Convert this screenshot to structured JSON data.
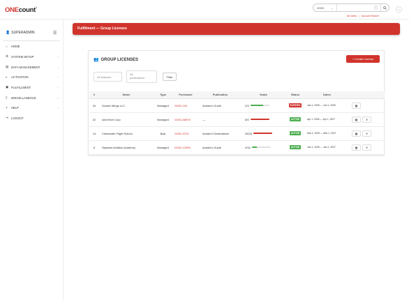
{
  "header": {
    "logo_one": "ONE",
    "logo_count": "count",
    "logo_tm": "®",
    "search_category": "GOID",
    "search_placeholder": "",
    "search_shortcut": "/",
    "link_all_users": "All Users",
    "link_separator": "|",
    "link_account_search": "Account Search"
  },
  "sidebar": {
    "user": "SUPERADMIN",
    "items": [
      {
        "label": "HOME",
        "icon": "home-icon",
        "glyph": "⌂",
        "arrow": ""
      },
      {
        "label": "SYSTEM SETUP",
        "icon": "gear-icon",
        "glyph": "⚙",
        "arrow": "‹"
      },
      {
        "label": "DATA MANAGEMENT",
        "icon": "database-icon",
        "glyph": "▤",
        "arrow": "‹"
      },
      {
        "label": "ACTIVATION",
        "icon": "toggle-icon",
        "glyph": "◐",
        "arrow": "‹"
      },
      {
        "label": "FULFILLMENT",
        "icon": "box-icon",
        "glyph": "▣",
        "arrow": "‹"
      },
      {
        "label": "MISCELLANEOUS",
        "icon": "file-icon",
        "glyph": "▯",
        "arrow": "‹"
      },
      {
        "label": "HELP",
        "icon": "question-icon",
        "glyph": "?",
        "arrow": "‹"
      },
      {
        "label": "LOGOUT",
        "icon": "logout-icon",
        "glyph": "⇥",
        "arrow": ""
      }
    ]
  },
  "banner": {
    "title": "Fulfillment — Group Licenses"
  },
  "card": {
    "title": "GROUP LICENSES",
    "create_label": "+ Create License",
    "filter_status": "All statuses",
    "filter_pub_line1": "All",
    "filter_pub_line2": "publications",
    "filter_button": "Filter"
  },
  "table": {
    "columns": [
      "#",
      "Name",
      "Type",
      "Purchaser",
      "Publication",
      "Seats",
      "Status",
      "Dates",
      ""
    ],
    "rows": [
      {
        "id": "20",
        "name": "Sunset Wings LLC",
        "type": "Managed",
        "purchaser": "GOID-244",
        "publication": "Aviator's Guide",
        "seats": "2/3",
        "fill": 0.67,
        "fill_color": "#4caf50",
        "status": "EXPIRED",
        "status_color": "#d0342c",
        "dates": "Jan 1, 2025 — Jun 1, 2026",
        "actions": [
          "view"
        ]
      },
      {
        "id": "22",
        "name": "AeroTech Corp",
        "type": "Managed",
        "purchaser": "GOID-5897K",
        "publication": "—",
        "seats": "5/5",
        "fill": 1.0,
        "fill_color": "#d0342c",
        "status": "ACTIVE",
        "status_color": "#4caf50",
        "dates": "Apr 1, 2025 — Apr 1, 2027",
        "actions": [
          "view",
          "delete"
        ]
      },
      {
        "id": "14",
        "name": "Clearwater Flight School",
        "type": "Bulk",
        "purchaser": "GOID-3723",
        "publication": "Aviator's Destinations",
        "seats": "25/25",
        "fill": 1.0,
        "fill_color": "#d0342c",
        "status": "ACTIVE",
        "status_color": "#4caf50",
        "dates": "Mar 1, 2025 — Mar 1, 2027",
        "actions": [
          "view",
          "delete"
        ]
      },
      {
        "id": "8",
        "name": "Skyward Aviation Academy",
        "type": "Managed",
        "purchaser": "GOID-12999",
        "publication": "Aviator's Guide",
        "seats": "4/15",
        "fill": 0.27,
        "fill_color": "#4caf50",
        "status": "ACTIVE",
        "status_color": "#4caf50",
        "dates": "Jan 1, 2025 — Jan 1, 2027",
        "actions": [
          "view",
          "delete"
        ]
      }
    ]
  }
}
